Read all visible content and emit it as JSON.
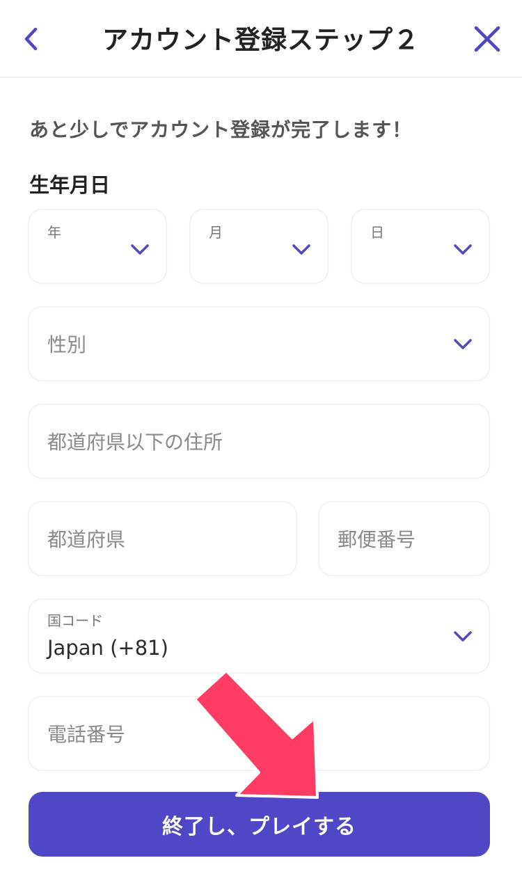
{
  "header": {
    "title": "アカウント登録ステップ２",
    "back_icon": "chevron-left-icon",
    "close_icon": "close-icon"
  },
  "intro_text": "あと少しでアカウント登録が完了します！",
  "birthdate": {
    "label": "生年月日",
    "year_label": "年",
    "month_label": "月",
    "day_label": "日"
  },
  "gender": {
    "placeholder": "性別"
  },
  "address": {
    "placeholder": "都道府県以下の住所"
  },
  "prefecture": {
    "placeholder": "都道府県"
  },
  "postal_code": {
    "placeholder": "郵便番号"
  },
  "country_code": {
    "label": "国コード",
    "value": "Japan (+81)"
  },
  "phone": {
    "placeholder": "電話番号"
  },
  "submit_button": {
    "label": "終了し、プレイする"
  },
  "colors": {
    "accent": "#5047c6",
    "arrow": "#ff3d64"
  }
}
